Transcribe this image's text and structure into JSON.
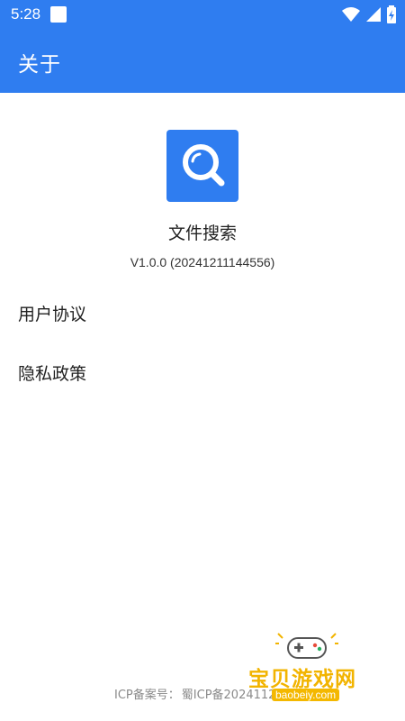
{
  "status_bar": {
    "time": "5:28",
    "icons": [
      "notification-square-icon",
      "wifi-icon",
      "signal-icon",
      "battery-charging-icon"
    ]
  },
  "app_bar": {
    "title": "关于"
  },
  "app_info": {
    "logo_icon": "magnifier-icon",
    "name": "文件搜索",
    "version": "V1.0.0 (20241211144556)"
  },
  "menu": {
    "items": [
      {
        "label": "用户协议"
      },
      {
        "label": "隐私政策"
      }
    ]
  },
  "footer": {
    "icp_label": "ICP备案号：",
    "icp_value": "蜀ICP备202411296"
  },
  "watermark": {
    "title": "宝贝游戏网",
    "url": "baobeiy.com"
  },
  "colors": {
    "primary": "#2f7df0",
    "text": "#222222",
    "muted": "#8a8a8a",
    "watermark": "#f2b400"
  }
}
